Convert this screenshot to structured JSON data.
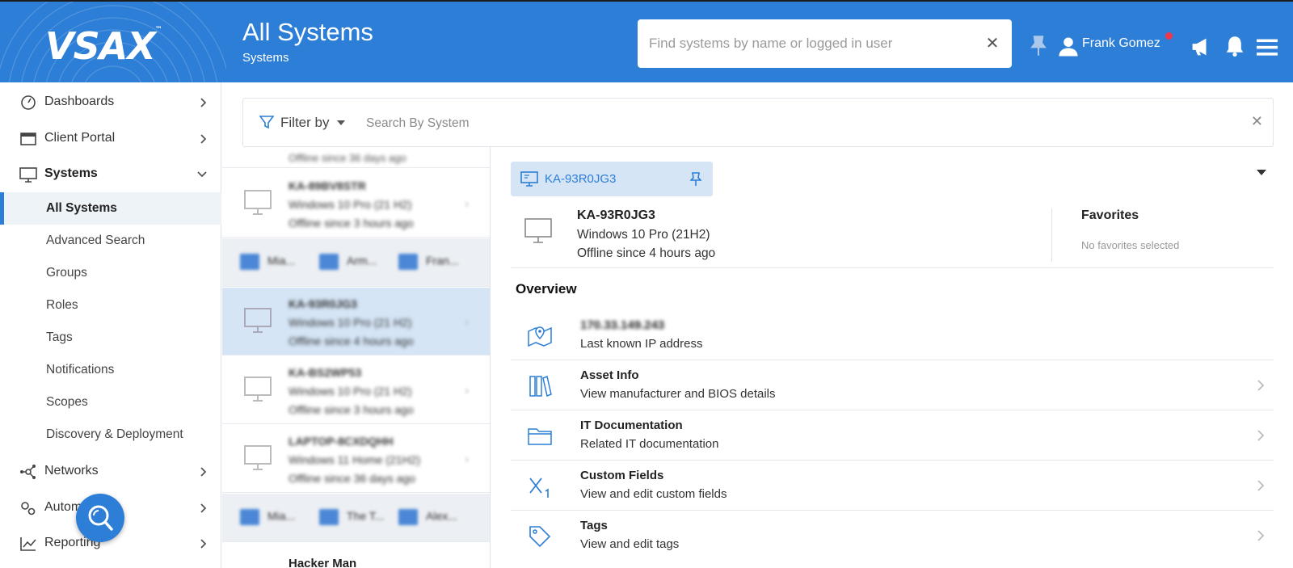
{
  "header": {
    "logo": "VSAX",
    "logo_tm": "™",
    "title": "All Systems",
    "subtitle": "Systems",
    "search_placeholder": "Find systems by name or logged in user",
    "user_name": "Frank Gomez",
    "brand_color": "#2c7ed6",
    "icons": [
      "pin-icon",
      "user-icon",
      "megaphone-icon",
      "bell-icon",
      "hamburger-menu-icon"
    ]
  },
  "sidebar": {
    "top_items": [
      {
        "label": "Dashboards",
        "icon": "gauge-icon"
      },
      {
        "label": "Client Portal",
        "icon": "window-icon"
      },
      {
        "label": "Systems",
        "icon": "monitor-icon",
        "expanded": true
      }
    ],
    "sub_items": [
      {
        "label": "All Systems",
        "active": true
      },
      {
        "label": "Advanced Search"
      },
      {
        "label": "Groups"
      },
      {
        "label": "Roles"
      },
      {
        "label": "Tags"
      },
      {
        "label": "Notifications"
      },
      {
        "label": "Scopes"
      },
      {
        "label": "Discovery & Deployment"
      }
    ],
    "bottom_items": [
      {
        "label": "Networks",
        "icon": "network-icon"
      },
      {
        "label": "Autom",
        "icon": "gears-icon"
      },
      {
        "label": "Reporting",
        "icon": "chart-line-icon"
      }
    ]
  },
  "filter": {
    "label": "Filter by",
    "search_placeholder": "Search By System"
  },
  "system_list": {
    "rows": [
      {
        "name": "KA-89BV8STR",
        "os": "Windows 10 Pro (21 H2)",
        "status": "Offline since 3 hours ago"
      },
      {
        "name": "KA-93R0JG3",
        "os": "Windows 10 Pro (21 H2)",
        "status": "Offline since 4 hours ago",
        "selected": true
      },
      {
        "name": "KA-BS2WP53",
        "os": "Windows 10 Pro (21 H2)",
        "status": "Offline since 3 hours ago"
      },
      {
        "name": "LAPTOP-8CXDQHH",
        "os": "Windows 11 Home (21H2)",
        "status": "Offline since 36 days ago"
      }
    ],
    "strip1": [
      "Mia...",
      "Arm...",
      "Fran..."
    ],
    "strip2": [
      "Mia...",
      "The T...",
      "Alex..."
    ],
    "last_name": "Hacker Man"
  },
  "detail": {
    "pill_name": "KA-93R0JG3",
    "system_name": "KA-93R0JG3",
    "os": "Windows 10 Pro (21H2)",
    "status": "Offline since 4 hours ago",
    "favorites_title": "Favorites",
    "favorites_empty": "No favorites selected",
    "overview_title": "Overview",
    "overview": [
      {
        "title": "170.33.149.243",
        "desc": "Last known IP address",
        "icon": "map-pin-icon"
      },
      {
        "title": "Asset Info",
        "desc": "View manufacturer and BIOS details",
        "icon": "books-icon"
      },
      {
        "title": "IT Documentation",
        "desc": "Related IT documentation",
        "icon": "folder-icon"
      },
      {
        "title": "Custom Fields",
        "desc": "View and edit custom fields",
        "icon": "variable-x1-icon"
      },
      {
        "title": "Tags",
        "desc": "View and edit tags",
        "icon": "tag-icon"
      }
    ]
  }
}
